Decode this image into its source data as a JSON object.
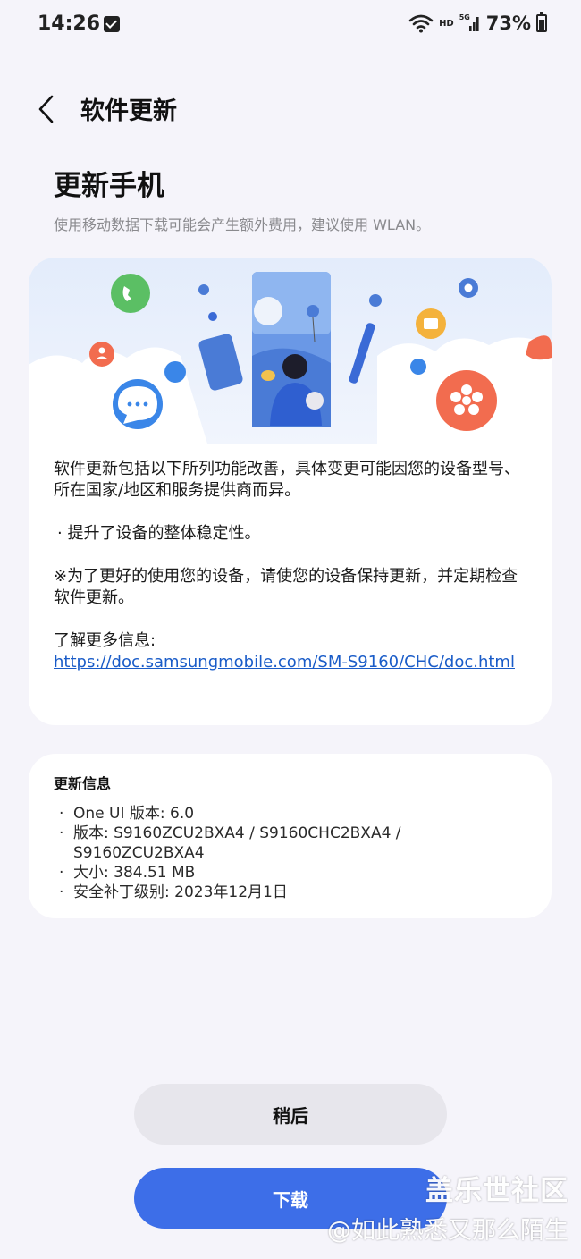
{
  "status_bar": {
    "time": "14:26",
    "hd": "HD",
    "network": "5G",
    "battery": "73%"
  },
  "header": {
    "title": "软件更新"
  },
  "page": {
    "title": "更新手机",
    "subtitle": "使用移动数据下载可能会产生额外费用，建议使用 WLAN。"
  },
  "notes": {
    "intro": "软件更新包括以下所列功能改善，具体变更可能因您的设备型号、所在国家/地区和服务提供商而异。",
    "bullet": "·  提升了设备的整体稳定性。",
    "reminder": "※为了更好的使用您的设备，请使您的设备保持更新，并定期检查软件更新。",
    "more_label": "了解更多信息:",
    "link": "https://doc.samsungmobile.com/SM-S9160/CHC/doc.html"
  },
  "update_info": {
    "title": "更新信息",
    "items": [
      "One UI 版本:  6.0",
      "版本:  S9160ZCU2BXA4 / S9160CHC2BXA4 / S9160ZCU2BXA4",
      "大小:  384.51 MB",
      "安全补丁级别:   2023年12月1日"
    ]
  },
  "buttons": {
    "later": "稍后",
    "download": "下载"
  },
  "watermark": {
    "line1": "盖乐世社区",
    "line2": "@如此熟悉又那么陌生"
  },
  "colors": {
    "accent": "#3d6ee8",
    "link": "#1a5cc8",
    "background": "#f5f4fa"
  }
}
